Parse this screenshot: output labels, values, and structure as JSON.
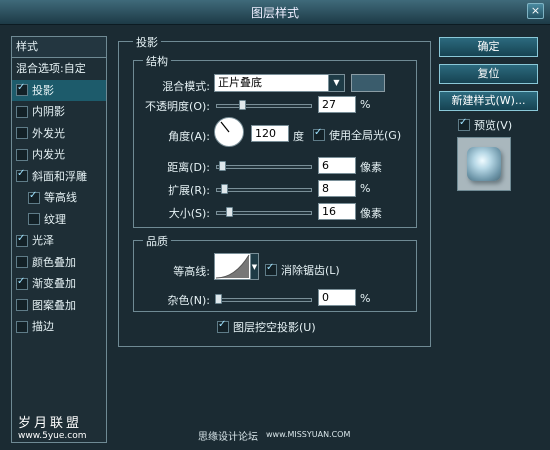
{
  "window": {
    "title": "图层样式",
    "close_label": "×"
  },
  "styles_panel": {
    "header": "样式",
    "blend_options": "混合选项:自定",
    "items": [
      {
        "label": "投影",
        "checked": true,
        "selected": true,
        "indent": false
      },
      {
        "label": "内阴影",
        "checked": false,
        "selected": false,
        "indent": false
      },
      {
        "label": "外发光",
        "checked": false,
        "selected": false,
        "indent": false
      },
      {
        "label": "内发光",
        "checked": false,
        "selected": false,
        "indent": false
      },
      {
        "label": "斜面和浮雕",
        "checked": true,
        "selected": false,
        "indent": false
      },
      {
        "label": "等高线",
        "checked": true,
        "selected": false,
        "indent": true
      },
      {
        "label": "纹理",
        "checked": false,
        "selected": false,
        "indent": true
      },
      {
        "label": "光泽",
        "checked": true,
        "selected": false,
        "indent": false
      },
      {
        "label": "颜色叠加",
        "checked": false,
        "selected": false,
        "indent": false
      },
      {
        "label": "渐变叠加",
        "checked": true,
        "selected": false,
        "indent": false
      },
      {
        "label": "图案叠加",
        "checked": false,
        "selected": false,
        "indent": false
      },
      {
        "label": "描边",
        "checked": false,
        "selected": false,
        "indent": false
      }
    ]
  },
  "drop_shadow": {
    "group_title": "投影",
    "structure_title": "结构",
    "blend_mode_label": "混合模式:",
    "blend_mode_value": "正片叠底",
    "shadow_color": "#3a5c6c",
    "opacity_label": "不透明度(O):",
    "opacity_value": "27",
    "opacity_unit": "%",
    "angle_label": "角度(A):",
    "angle_value": "120",
    "angle_unit": "度",
    "global_light_label": "使用全局光(G)",
    "global_light_checked": true,
    "distance_label": "距离(D):",
    "distance_value": "6",
    "distance_unit": "像素",
    "spread_label": "扩展(R):",
    "spread_value": "8",
    "spread_unit": "%",
    "size_label": "大小(S):",
    "size_value": "16",
    "size_unit": "像素",
    "quality_title": "品质",
    "contour_label": "等高线:",
    "anti_alias_label": "消除锯齿(L)",
    "anti_alias_checked": true,
    "noise_label": "杂色(N):",
    "noise_value": "0",
    "noise_unit": "%",
    "knockout_label": "图层挖空投影(U)",
    "knockout_checked": true
  },
  "buttons": {
    "ok": "确定",
    "reset": "复位",
    "new_style": "新建样式(W)...",
    "preview_label": "预览(V)",
    "preview_checked": true
  },
  "watermarks": {
    "left_top": "岁月联盟",
    "left_bottom": "www.5yue.com",
    "center": "思缘设计论坛",
    "center_url": "www.MISSYUAN.COM"
  }
}
